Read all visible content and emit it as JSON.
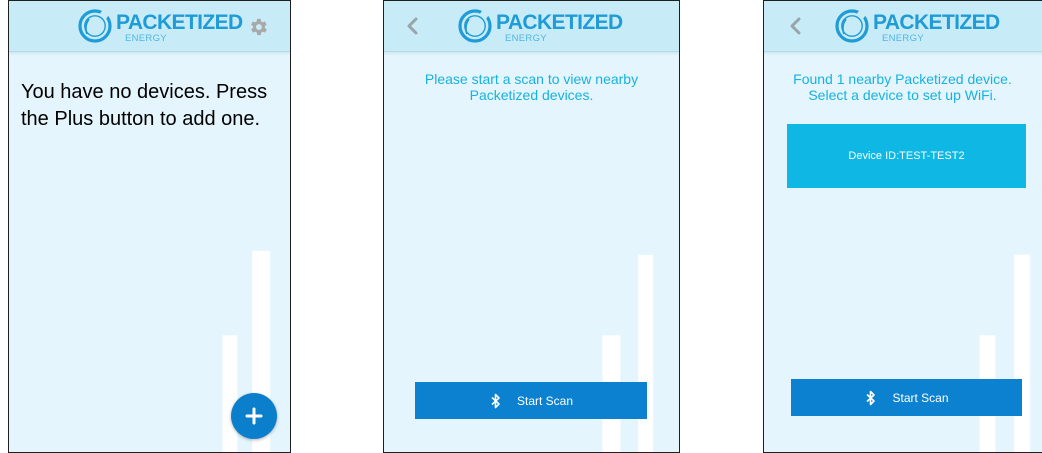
{
  "brand": {
    "name": "PACKETIZED",
    "subtitle": "ENERGY",
    "primary_color": "#1f9bd7",
    "header_color": "#c8ecf7",
    "background_color": "#e5f5fd",
    "accent_text_color": "#17b2e0",
    "button_color": "#0b81cf",
    "card_color": "#0fb7e5"
  },
  "screens": [
    {
      "id": "devices-empty",
      "header": {
        "left_icon": "none",
        "right_icon": "gear-icon"
      },
      "message": "You have no devices. Press the Plus button to add one.",
      "fab": {
        "icon": "plus-icon"
      }
    },
    {
      "id": "scan-start",
      "header": {
        "left_icon": "chevron-left-icon"
      },
      "message": "Please start a scan to view nearby\nPacketized devices.",
      "scan_button": {
        "label": "Start Scan",
        "icon": "bluetooth-icon"
      }
    },
    {
      "id": "scan-results",
      "header": {
        "left_icon": "chevron-left-icon"
      },
      "message": "Found 1 nearby Packetized device.\nSelect a device to set up WiFi.",
      "devices": [
        {
          "label": "Device ID:TEST-TEST2"
        }
      ],
      "scan_button": {
        "label": "Start Scan",
        "icon": "bluetooth-icon"
      }
    }
  ]
}
